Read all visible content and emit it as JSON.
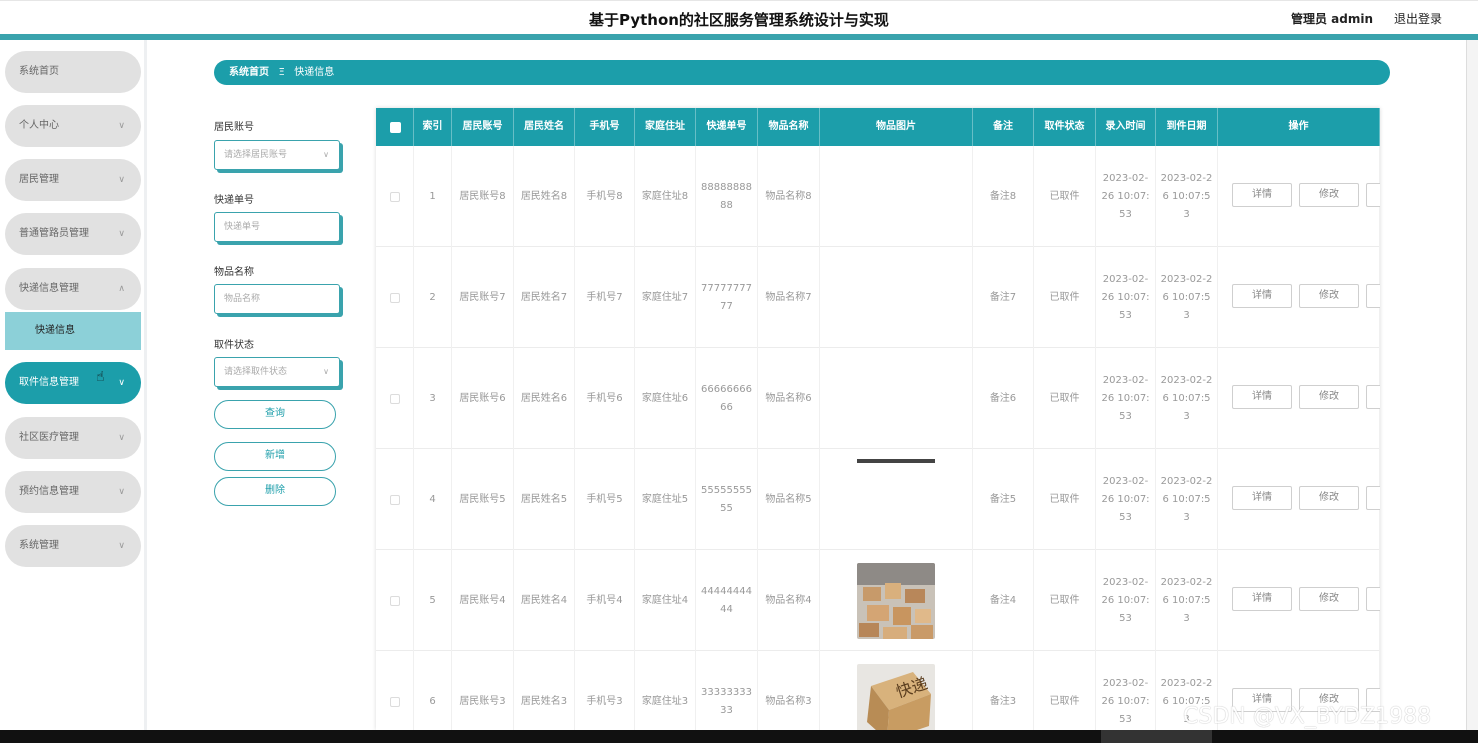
{
  "header": {
    "title": "基于Python的社区服务管理系统设计与实现",
    "admin": "管理员 admin",
    "logout": "退出登录"
  },
  "sidebar": {
    "items": [
      {
        "label": "系统首页",
        "has_chevron": false
      },
      {
        "label": "个人中心",
        "has_chevron": true
      },
      {
        "label": "居民管理",
        "has_chevron": true
      },
      {
        "label": "普通管路员管理",
        "has_chevron": true
      },
      {
        "label": "快递信息管理",
        "has_chevron": true,
        "expanded": true
      },
      {
        "label": "取件信息管理",
        "has_chevron": true,
        "active": true
      },
      {
        "label": "社区医疗管理",
        "has_chevron": true
      },
      {
        "label": "预约信息管理",
        "has_chevron": true
      },
      {
        "label": "系统管理",
        "has_chevron": true
      }
    ],
    "sub_item": "快递信息"
  },
  "breadcrumb": {
    "home": "系统首页",
    "separator": "Ξ",
    "current": "快递信息"
  },
  "filters": {
    "resident_account": {
      "label": "居民账号",
      "placeholder": "请选择居民账号"
    },
    "tracking_no": {
      "label": "快递单号",
      "placeholder": "快递单号"
    },
    "item_name": {
      "label": "物品名称",
      "placeholder": "物品名称"
    },
    "pickup_status": {
      "label": "取件状态",
      "placeholder": "请选择取件状态"
    },
    "search_button": "查询",
    "add_button": "新增",
    "delete_button": "删除"
  },
  "table": {
    "columns": [
      "索引",
      "居民账号",
      "居民姓名",
      "手机号",
      "家庭住址",
      "快递单号",
      "物品名称",
      "物品图片",
      "备注",
      "取件状态",
      "录入时间",
      "到件日期",
      "操作"
    ],
    "detail_label": "详情",
    "edit_label": "修改",
    "rows": [
      {
        "index": "1",
        "account": "居民账号8",
        "name": "居民姓名8",
        "phone": "手机号8",
        "address": "家庭住址8",
        "tracking": "8888888888",
        "item": "物品名称8",
        "image": "none",
        "note": "备注8",
        "status": "已取件",
        "created": "2023-02-26 10:07:53",
        "arrival": "2023-02-26 10:07:53"
      },
      {
        "index": "2",
        "account": "居民账号7",
        "name": "居民姓名7",
        "phone": "手机号7",
        "address": "家庭住址7",
        "tracking": "7777777777",
        "item": "物品名称7",
        "image": "none",
        "note": "备注7",
        "status": "已取件",
        "created": "2023-02-26 10:07:53",
        "arrival": "2023-02-26 10:07:53"
      },
      {
        "index": "3",
        "account": "居民账号6",
        "name": "居民姓名6",
        "phone": "手机号6",
        "address": "家庭住址6",
        "tracking": "6666666666",
        "item": "物品名称6",
        "image": "none",
        "note": "备注6",
        "status": "已取件",
        "created": "2023-02-26 10:07:53",
        "arrival": "2023-02-26 10:07:53"
      },
      {
        "index": "4",
        "account": "居民账号5",
        "name": "居民姓名5",
        "phone": "手机号5",
        "address": "家庭住址5",
        "tracking": "5555555555",
        "item": "物品名称5",
        "image": "strip",
        "note": "备注5",
        "status": "已取件",
        "created": "2023-02-26 10:07:53",
        "arrival": "2023-02-26 10:07:53"
      },
      {
        "index": "5",
        "account": "居民账号4",
        "name": "居民姓名4",
        "phone": "手机号4",
        "address": "家庭住址4",
        "tracking": "4444444444",
        "item": "物品名称4",
        "image": "parcels",
        "note": "备注4",
        "status": "已取件",
        "created": "2023-02-26 10:07:53",
        "arrival": "2023-02-26 10:07:53"
      },
      {
        "index": "6",
        "account": "居民账号3",
        "name": "居民姓名3",
        "phone": "手机号3",
        "address": "家庭住址3",
        "tracking": "3333333333",
        "item": "物品名称3",
        "image": "box",
        "note": "备注3",
        "status": "已取件",
        "created": "2023-02-26 10:07:53",
        "arrival": "2023-02-26 10:07:53"
      }
    ]
  },
  "watermark": "CSDN @VX_BYDZ1988",
  "colors": {
    "accent": "#1c9eaa",
    "accent_light": "#8cd0d8",
    "menu_bg": "#e1e1e1"
  }
}
